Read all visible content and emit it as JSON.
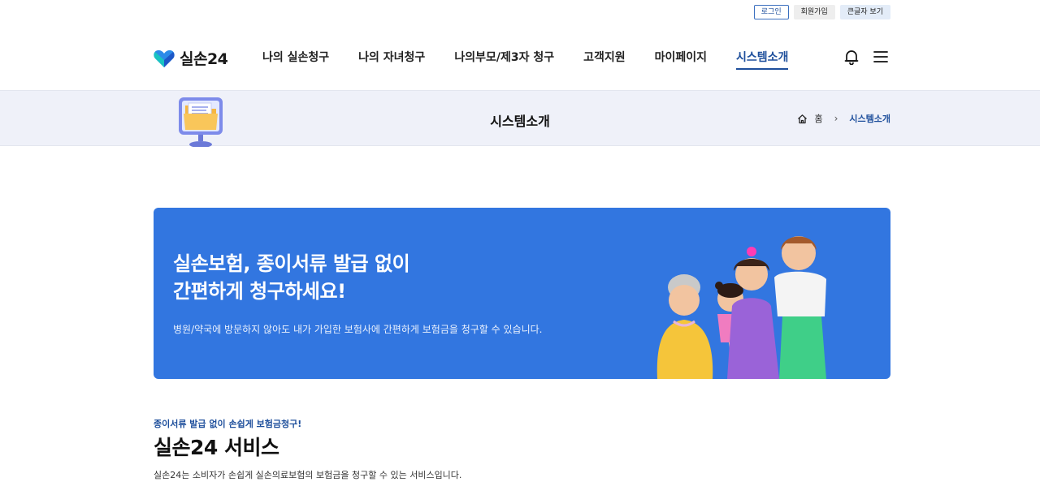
{
  "utility": {
    "login": "로그인",
    "join": "회원가입",
    "big_text": "큰글자 보기"
  },
  "header": {
    "logo_text": "실손24",
    "nav": [
      {
        "label": "나의 실손청구"
      },
      {
        "label": "나의 자녀청구"
      },
      {
        "label": "나의부모/제3자 청구"
      },
      {
        "label": "고객지원"
      },
      {
        "label": "마이페이지"
      },
      {
        "label": "시스템소개",
        "active": true
      }
    ],
    "icons": [
      "bell-icon",
      "hamburger-menu-icon"
    ]
  },
  "subbar": {
    "title": "시스템소개",
    "breadcrumb": {
      "home": "홈",
      "current": "시스템소개"
    }
  },
  "banner": {
    "headline_line1": "실손보험, 종이서류 발급 없이",
    "headline_line2": "간편하게 청구하세요!",
    "description": "병원/약국에 방문하지 않아도 내가 가입한 보험사에 간편하게 보험금을 청구할 수 있습니다."
  },
  "service": {
    "subtitle": "종이서류 발급 없이 손쉽게 보험금청구!",
    "title": "실손24 서비스",
    "description": "실손24는 소비자가 손쉽게 실손의료보험의 보험금을 청구할 수 있는 서비스입니다."
  },
  "colors": {
    "brand": "#1e4f9c",
    "banner": "#3276e0",
    "subbar": "#eff1f9"
  }
}
